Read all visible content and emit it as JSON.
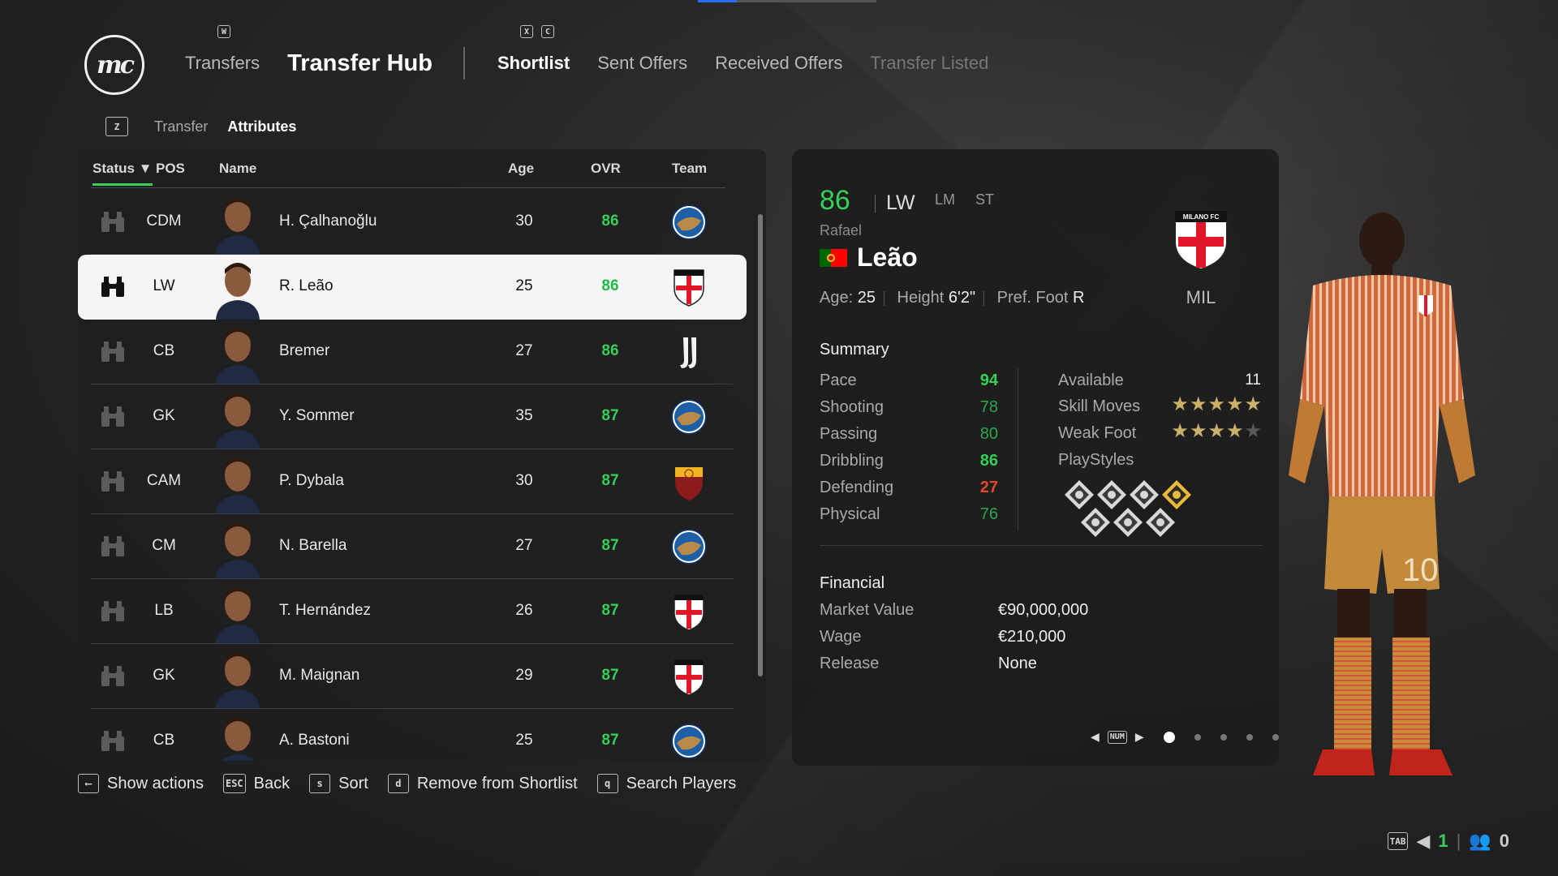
{
  "header": {
    "logo": "mc",
    "key_left": "W",
    "key_right": [
      "X",
      "C"
    ],
    "transfers_label": "Transfers",
    "hub_label": "Transfer Hub",
    "tabs": [
      {
        "label": "Shortlist",
        "state": "active"
      },
      {
        "label": "Sent Offers",
        "state": "normal"
      },
      {
        "label": "Received Offers",
        "state": "normal"
      },
      {
        "label": "Transfer Listed",
        "state": "dim"
      }
    ]
  },
  "subnav": {
    "key": "Z",
    "items": [
      "Transfer",
      "Attributes"
    ],
    "active": "Attributes"
  },
  "table": {
    "columns": {
      "status": "Status ▼",
      "pos": "POS",
      "name": "Name",
      "age": "Age",
      "ovr": "OVR",
      "team": "Team"
    },
    "rows": [
      {
        "pos": "CDM",
        "name": "H. Çalhanoğlu",
        "age": "30",
        "ovr": "86",
        "team": "inter"
      },
      {
        "pos": "LW",
        "name": "R. Leão",
        "age": "25",
        "ovr": "86",
        "team": "milan",
        "selected": true
      },
      {
        "pos": "CB",
        "name": "Bremer",
        "age": "27",
        "ovr": "86",
        "team": "juventus"
      },
      {
        "pos": "GK",
        "name": "Y. Sommer",
        "age": "35",
        "ovr": "87",
        "team": "inter"
      },
      {
        "pos": "CAM",
        "name": "P. Dybala",
        "age": "30",
        "ovr": "87",
        "team": "roma"
      },
      {
        "pos": "CM",
        "name": "N. Barella",
        "age": "27",
        "ovr": "87",
        "team": "inter"
      },
      {
        "pos": "LB",
        "name": "T. Hernández",
        "age": "26",
        "ovr": "87",
        "team": "milan"
      },
      {
        "pos": "GK",
        "name": "M. Maignan",
        "age": "29",
        "ovr": "87",
        "team": "milan"
      },
      {
        "pos": "CB",
        "name": "A. Bastoni",
        "age": "25",
        "ovr": "87",
        "team": "inter"
      }
    ]
  },
  "actions": [
    {
      "key": "⟵",
      "label": "Show actions"
    },
    {
      "key": "ESC",
      "label": "Back"
    },
    {
      "key": "s",
      "label": "Sort"
    },
    {
      "key": "d",
      "label": "Remove from Shortlist"
    },
    {
      "key": "q",
      "label": "Search Players"
    }
  ],
  "detail": {
    "ovr": "86",
    "position": "LW",
    "alt_positions": [
      "LM",
      "ST"
    ],
    "first_name": "Rafael",
    "last_name": "Leão",
    "age_label": "Age:",
    "age": "25",
    "height_label": "Height",
    "height": "6'2\"",
    "foot_label": "Pref. Foot",
    "foot": "R",
    "club_abbr": "MIL",
    "crest_text": "MILANO FC",
    "summary_title": "Summary",
    "attributes": [
      {
        "label": "Pace",
        "value": "94",
        "tone": "g1"
      },
      {
        "label": "Shooting",
        "value": "78",
        "tone": "g2"
      },
      {
        "label": "Passing",
        "value": "80",
        "tone": "g2"
      },
      {
        "label": "Dribbling",
        "value": "86",
        "tone": "g1"
      },
      {
        "label": "Defending",
        "value": "27",
        "tone": "r"
      },
      {
        "label": "Physical",
        "value": "76",
        "tone": "g2"
      }
    ],
    "available_label": "Available",
    "available": "11",
    "skill_moves_label": "Skill Moves",
    "skill_moves": 5,
    "weak_foot_label": "Weak Foot",
    "weak_foot": 4,
    "playstyles_label": "PlayStyles",
    "playstyles_count": 7,
    "financial_title": "Financial",
    "financial": [
      {
        "label": "Market Value",
        "value": "€90,000,000"
      },
      {
        "label": "Wage",
        "value": "€210,000"
      },
      {
        "label": "Release",
        "value": "None"
      }
    ],
    "pager_key": "NUM",
    "page_count": 5,
    "page_active": 1
  },
  "status_bar": {
    "tab_key": "TAB",
    "count_a": "1",
    "count_b": "0"
  },
  "colors": {
    "accent_green": "#34d058",
    "low_red": "#e24a2a",
    "star_gold": "#c9b16a"
  }
}
